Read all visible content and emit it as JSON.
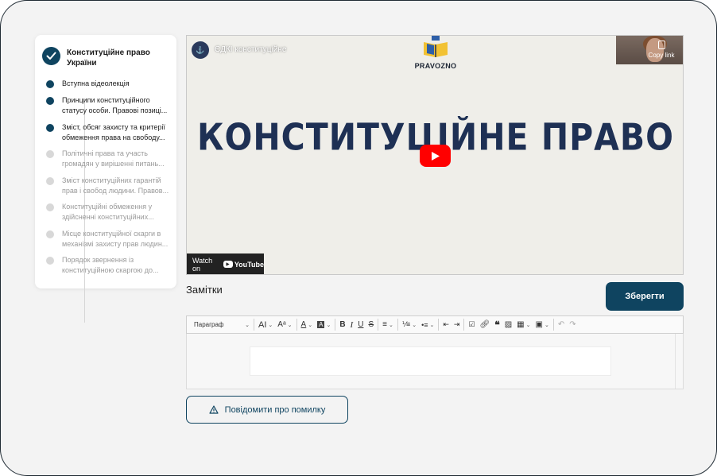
{
  "course": {
    "title": "Конституційне право України",
    "lessons": [
      {
        "label": "Вступна відеолекція",
        "done": true
      },
      {
        "label": "Принципи конституційного статусу особи. Правові позиці...",
        "done": true
      },
      {
        "label": "Зміст, обсяг захисту та критерії обмеження права на свободу...",
        "done": true
      },
      {
        "label": "Політичні права та участь громадян у вирішенні питань...",
        "done": false
      },
      {
        "label": "Зміст конституційних гарантій прав і свобод людини. Правов...",
        "done": false
      },
      {
        "label": "Конституційні обмеження у здійсненні конституційних...",
        "done": false
      },
      {
        "label": "Місце конституційної скарги в механізмі захисту прав людин...",
        "done": false
      },
      {
        "label": "Порядок звернення із конституційною скаргою до...",
        "done": false
      }
    ]
  },
  "video": {
    "channel_title": "ЄДКІ конституційне",
    "logo_text": "PRAVOZNO",
    "copy_link_label": "Copy link",
    "headline": "КОНСТИТУЦІЙНЕ ПРАВО",
    "watch_on": "Watch on",
    "youtube": "YouTube"
  },
  "notes": {
    "title": "Замітки",
    "save_label": "Зберегти",
    "paragraph_select": "Параграф"
  },
  "report": {
    "label": "Повідомити про помилку"
  },
  "colors": {
    "accent": "#0f4460",
    "frame_bg": "#f3f3f3",
    "headline": "#1e3054",
    "youtube_red": "#ff0000"
  }
}
